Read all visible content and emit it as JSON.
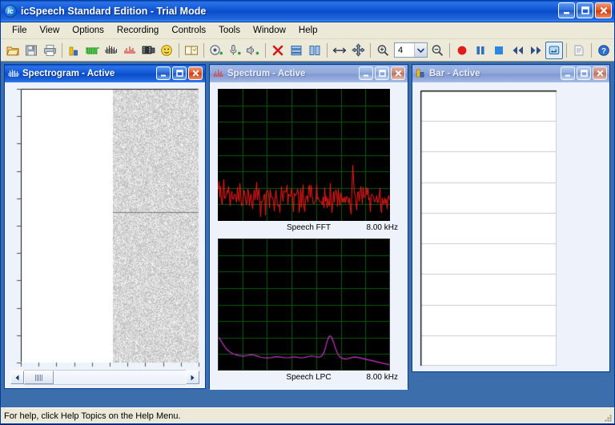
{
  "window": {
    "title_main": "icSpeech Standard Edition",
    "title_sep": " - ",
    "title_mode": "Trial Mode",
    "app_icon": "ic-logo-icon",
    "buttons": {
      "minimize": "minimize-icon",
      "maximize": "maximize-icon",
      "close": "close-icon"
    }
  },
  "menu": {
    "items": [
      {
        "label": "File"
      },
      {
        "label": "View"
      },
      {
        "label": "Options"
      },
      {
        "label": "Recording"
      },
      {
        "label": "Controls"
      },
      {
        "label": "Tools"
      },
      {
        "label": "Window"
      },
      {
        "label": "Help"
      }
    ]
  },
  "toolbar": {
    "zoom_value": "4",
    "buttons": [
      {
        "name": "open-file-icon",
        "tooltip": "Open"
      },
      {
        "name": "save-file-icon",
        "tooltip": "Save"
      },
      {
        "name": "print-icon",
        "tooltip": "Print"
      },
      {
        "name": "bar-view-icon",
        "tooltip": "Bar"
      },
      {
        "name": "waveform-view-icon",
        "tooltip": "Waveform"
      },
      {
        "name": "spectrogram-view-icon",
        "tooltip": "Spectrogram"
      },
      {
        "name": "spectrum-view-icon",
        "tooltip": "Spectrum"
      },
      {
        "name": "video-view-icon",
        "tooltip": "Video"
      },
      {
        "name": "face-view-icon",
        "tooltip": "Face"
      },
      {
        "name": "dictionary-icon",
        "tooltip": "Dictionary"
      },
      {
        "name": "add-recording-icon",
        "tooltip": "Add Recording"
      },
      {
        "name": "add-microphone-icon",
        "tooltip": "Add Microphone"
      },
      {
        "name": "add-speaker-icon",
        "tooltip": "Add Speaker"
      },
      {
        "name": "delete-icon",
        "tooltip": "Delete"
      },
      {
        "name": "tile-horizontal-icon",
        "tooltip": "Tile Horizontally"
      },
      {
        "name": "tile-vertical-icon",
        "tooltip": "Tile Vertically"
      },
      {
        "name": "resize-width-icon",
        "tooltip": "Fit Width"
      },
      {
        "name": "move-icon",
        "tooltip": "Move"
      },
      {
        "name": "zoom-in-icon",
        "tooltip": "Zoom In"
      },
      {
        "name": "zoom-out-icon",
        "tooltip": "Zoom Out"
      },
      {
        "name": "record-icon",
        "tooltip": "Record"
      },
      {
        "name": "pause-icon",
        "tooltip": "Pause"
      },
      {
        "name": "stop-icon",
        "tooltip": "Stop"
      },
      {
        "name": "rewind-icon",
        "tooltip": "Rewind"
      },
      {
        "name": "fast-forward-icon",
        "tooltip": "Fast Forward"
      },
      {
        "name": "loop-icon",
        "tooltip": "Loop"
      },
      {
        "name": "report-icon",
        "tooltip": "Report"
      },
      {
        "name": "help-icon",
        "tooltip": "Help"
      }
    ]
  },
  "children": {
    "spectrogram": {
      "title_name": "Spectrogram",
      "title_sep": " - ",
      "title_state": "Active",
      "icon": "spectrogram-icon",
      "active": true,
      "scrollbar": {
        "left_arrow": "scroll-left-icon",
        "right_arrow": "scroll-right-icon"
      }
    },
    "spectrum": {
      "title_name": "Spectrum",
      "title_sep": " - ",
      "title_state": "Active",
      "icon": "spectrum-icon",
      "active": false,
      "fft_label": "Speech FFT",
      "fft_max_freq": "8.00 kHz",
      "lpc_label": "Speech LPC",
      "lpc_max_freq": "8.00 kHz"
    },
    "bar": {
      "title_name": "Bar",
      "title_sep": " - ",
      "title_state": "Active",
      "icon": "bar-icon",
      "active": false
    }
  },
  "statusbar": {
    "text": "For help, click Help Topics on the Help Menu."
  },
  "colors": {
    "titlebar_active": "#0b50cb",
    "titlebar_inactive": "#8fa8dc",
    "plot_background": "#000000",
    "plot_grid": "#0d5a0d",
    "fft_trace": "#ff1a1a",
    "lpc_trace": "#cc33cc",
    "chrome": "#ece9d8",
    "mdi_background": "#3c6eab"
  },
  "chart_data": [
    {
      "type": "line",
      "name": "speech-fft",
      "title": "Speech FFT",
      "xlabel": "",
      "ylabel": "",
      "xlim": [
        0,
        8
      ],
      "xlabel_right": "8.00 kHz",
      "x_unit": "kHz",
      "grid": true,
      "grid_cols": 7,
      "grid_rows": 8,
      "trace_color": "#ff1a1a",
      "background": "#000000",
      "description": "Dense noisy FFT magnitude spectrum, energy concentrated in the lower ~20% of the vertical range, with one taller spike near 5.5 kHz.",
      "series": [
        {
          "name": "FFT magnitude",
          "values": [
            0.3,
            0.18,
            0.22,
            0.15,
            0.25,
            0.19,
            0.23,
            0.17,
            0.21,
            0.14,
            0.2,
            0.16,
            0.24,
            0.13,
            0.22,
            0.18,
            0.26,
            0.12,
            0.19,
            0.15,
            0.23,
            0.1,
            0.21,
            0.17,
            0.25,
            0.11,
            0.18,
            0.14,
            0.22,
            0.16,
            0.2,
            0.09,
            0.19,
            0.13,
            0.24,
            0.15,
            0.21,
            0.12,
            0.18,
            0.16,
            0.23,
            0.11,
            0.2,
            0.14,
            0.17,
            0.08,
            0.22,
            0.13,
            0.19,
            0.15,
            0.24,
            0.1,
            0.21,
            0.16,
            0.18,
            0.12,
            0.23,
            0.14,
            0.2,
            0.09,
            0.17,
            0.15,
            0.22,
            0.11,
            0.19,
            0.13,
            0.25,
            0.16,
            0.21,
            0.1,
            0.18,
            0.14,
            0.23,
            0.12,
            0.2,
            0.17,
            0.15,
            0.08,
            0.22,
            0.13,
            0.19,
            0.16,
            0.24,
            0.11,
            0.21,
            0.14,
            0.18,
            0.12,
            0.2,
            0.15,
            0.23,
            0.09,
            0.17,
            0.13,
            0.22,
            0.16,
            0.19,
            0.11,
            0.38,
            0.2,
            0.24,
            0.13,
            0.18,
            0.15,
            0.21,
            0.1,
            0.23,
            0.14,
            0.19,
            0.17,
            0.22,
            0.12,
            0.2,
            0.15,
            0.18,
            0.13,
            0.21,
            0.16,
            0.19,
            0.11,
            0.17,
            0.14,
            0.2,
            0.12,
            0.18,
            0.15
          ]
        }
      ]
    },
    {
      "type": "line",
      "name": "speech-lpc",
      "title": "Speech LPC",
      "xlabel": "",
      "ylabel": "",
      "xlim": [
        0,
        8
      ],
      "xlabel_right": "8.00 kHz",
      "x_unit": "kHz",
      "grid": true,
      "grid_cols": 7,
      "grid_rows": 8,
      "trace_color": "#cc33cc",
      "background": "#000000",
      "description": "Smooth LPC envelope that decays from the left edge, runs flat near the bottom, then shows a sharp formant peak near 5.4 kHz before falling away.",
      "series": [
        {
          "name": "LPC envelope",
          "values": [
            0.24,
            0.22,
            0.2,
            0.18,
            0.16,
            0.145,
            0.135,
            0.125,
            0.118,
            0.112,
            0.108,
            0.104,
            0.101,
            0.099,
            0.098,
            0.098,
            0.1,
            0.103,
            0.106,
            0.107,
            0.106,
            0.103,
            0.099,
            0.095,
            0.091,
            0.088,
            0.086,
            0.085,
            0.084,
            0.084,
            0.085,
            0.087,
            0.09,
            0.092,
            0.093,
            0.092,
            0.09,
            0.088,
            0.086,
            0.085,
            0.085,
            0.086,
            0.088,
            0.09,
            0.091,
            0.09,
            0.088,
            0.086,
            0.085,
            0.085,
            0.087,
            0.09,
            0.094,
            0.097,
            0.098,
            0.097,
            0.094,
            0.091,
            0.09,
            0.092,
            0.1,
            0.12,
            0.16,
            0.21,
            0.245,
            0.25,
            0.23,
            0.19,
            0.15,
            0.118,
            0.098,
            0.086,
            0.08,
            0.077,
            0.076,
            0.078,
            0.082,
            0.086,
            0.089,
            0.09,
            0.089,
            0.087,
            0.084,
            0.081,
            0.078,
            0.075,
            0.072,
            0.069,
            0.066,
            0.063,
            0.06,
            0.057,
            0.054,
            0.051,
            0.048,
            0.045,
            0.042,
            0.039,
            0.036,
            0.033
          ]
        }
      ]
    },
    {
      "type": "heatmap",
      "name": "spectrogram",
      "title": "Spectrogram",
      "description": "Time-frequency spectrogram. Left ~52% of the pane is blank white (no signal yet); right portion is uniform grey broadband noise with a darker horizontal band at roughly 45% height.",
      "background": "#ffffff",
      "noise_color": "#c9c9c9",
      "blank_fraction": 0.52,
      "band_position": 0.45,
      "y_tick_count": 11,
      "x_tick_count": 10
    },
    {
      "type": "bar",
      "name": "bar-view",
      "title": "Bar",
      "description": "Empty bar view: white plot area with 9 horizontal gridlines and no bars drawn.",
      "background": "#ffffff",
      "grid_rows": 9,
      "categories": [],
      "values": []
    }
  ]
}
